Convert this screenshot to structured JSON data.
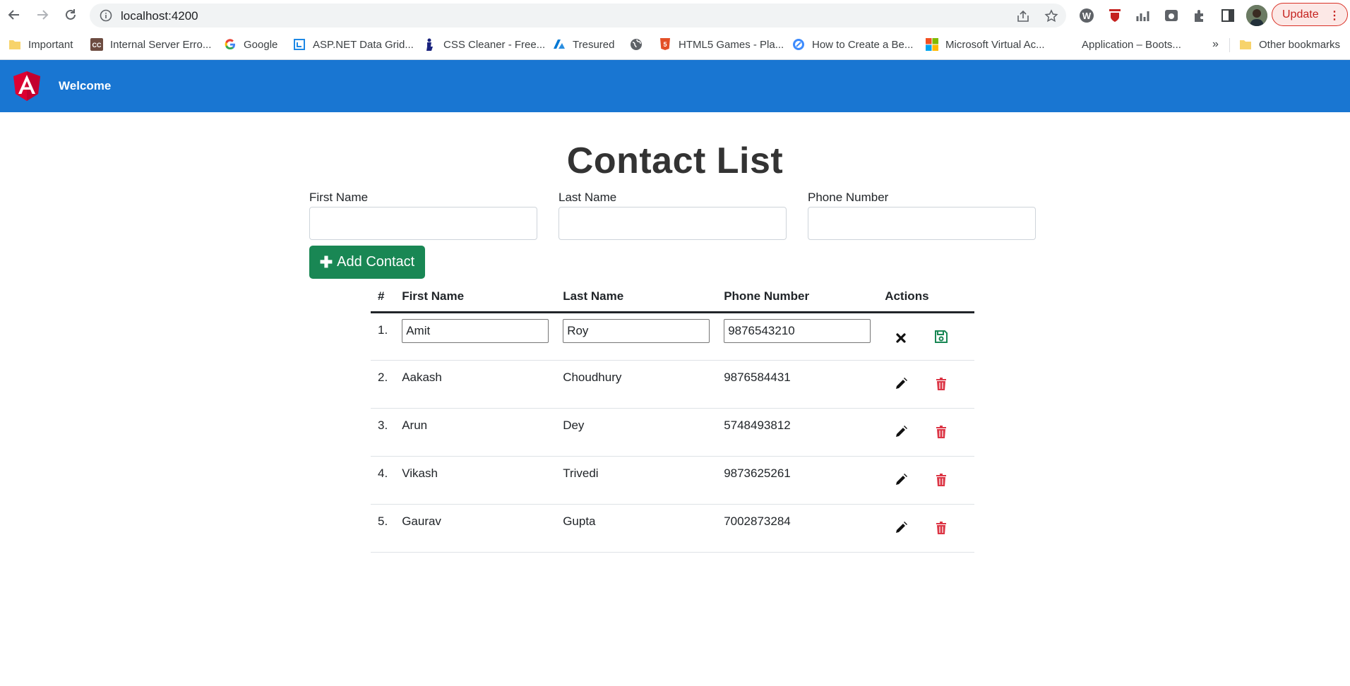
{
  "browser": {
    "url": "localhost:4200",
    "update_label": "Update",
    "more_label": "⋮",
    "bookmarks": [
      {
        "label": "Important",
        "icon": "folder-icon"
      },
      {
        "label": "Internal Server Erro...",
        "icon": "cc-icon"
      },
      {
        "label": "Google",
        "icon": "google-icon"
      },
      {
        "label": "ASP.NET Data Grid...",
        "icon": "grid-icon"
      },
      {
        "label": "CSS Cleaner - Free...",
        "icon": "broom-icon"
      },
      {
        "label": "Tresured",
        "icon": "azure-icon"
      },
      {
        "label": "",
        "icon": "globe-icon"
      },
      {
        "label": "HTML5 Games - Pla...",
        "icon": "html5-icon"
      },
      {
        "label": "How to Create a Be...",
        "icon": "gear-icon"
      },
      {
        "label": "Microsoft Virtual Ac...",
        "icon": "microsoft-icon"
      },
      {
        "label": "Application – Boots...",
        "icon": ""
      },
      {
        "label": "»",
        "icon": ""
      },
      {
        "label": "Other bookmarks",
        "icon": "folder-icon"
      }
    ]
  },
  "navbar": {
    "title": "Welcome"
  },
  "page": {
    "title": "Contact List",
    "form": {
      "first_name_label": "First Name",
      "last_name_label": "Last Name",
      "phone_label": "Phone Number",
      "first_name_value": "",
      "last_name_value": "",
      "phone_value": "",
      "add_button_label": "Add Contact"
    }
  },
  "table": {
    "headers": [
      "#",
      "First Name",
      "Last Name",
      "Phone Number",
      "Actions"
    ],
    "editing_row": {
      "index": "1.",
      "first": "Amit",
      "last": "Roy",
      "phone": "9876543210"
    },
    "rows": [
      {
        "index": "2.",
        "first": "Aakash",
        "last": "Choudhury",
        "phone": "9876584431"
      },
      {
        "index": "3.",
        "first": "Arun",
        "last": "Dey",
        "phone": "5748493812"
      },
      {
        "index": "4.",
        "first": "Vikash",
        "last": "Trivedi",
        "phone": "9873625261"
      },
      {
        "index": "5.",
        "first": "Gaurav",
        "last": "Gupta",
        "phone": "7002873284"
      }
    ]
  },
  "colors": {
    "navbar": "#1976d2",
    "add_button": "#198754",
    "delete": "#dc3545",
    "save": "#198754"
  }
}
